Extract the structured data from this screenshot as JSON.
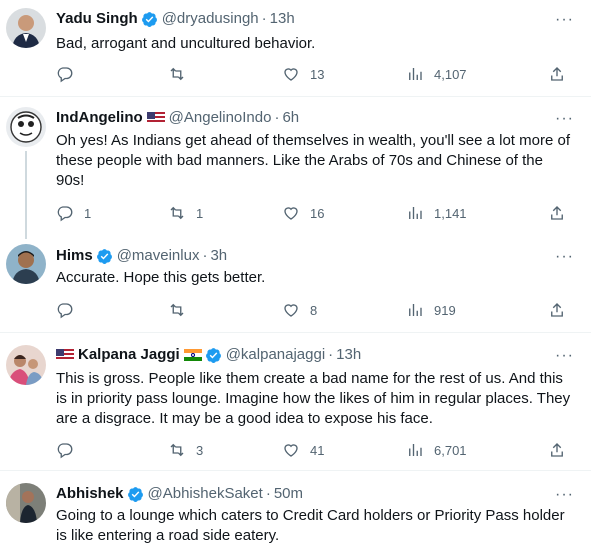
{
  "tweets": [
    {
      "name": "Yadu Singh",
      "handle": "@dryadusingh",
      "time": "13h",
      "text": "Bad, arrogant and uncultured behavior.",
      "replies": "",
      "retweets": "",
      "likes": "13",
      "views": "4,107"
    },
    {
      "name": "IndAngelino",
      "handle": "@AngelinoIndo",
      "time": "6h",
      "text": "Oh yes! As Indians get ahead of themselves in wealth, you'll see a lot more of these people with bad manners. Like the Arabs of 70s and Chinese of the 90s!",
      "replies": "1",
      "retweets": "1",
      "likes": "16",
      "views": "1,141"
    },
    {
      "name": "Hims",
      "handle": "@maveinlux",
      "time": "3h",
      "text": "Accurate. Hope this gets better.",
      "replies": "",
      "retweets": "",
      "likes": "8",
      "views": "919"
    },
    {
      "name": "Kalpana Jaggi",
      "handle": "@kalpanajaggi",
      "time": "13h",
      "text": "This is gross. People like them create a bad name for the rest of us. And this is in priority pass lounge. Imagine how the likes of him in regular places. They are a disgrace.  It may be a good idea to expose his face.",
      "replies": "",
      "retweets": "3",
      "likes": "41",
      "views": "6,701"
    },
    {
      "name": "Abhishek",
      "handle": "@AbhishekSaket",
      "time": "50m",
      "text": "Going to a lounge which caters to Credit Card holders or Priority Pass holder is like entering a road side eatery."
    }
  ],
  "dot": "·",
  "more_glyph": "···",
  "colors": {
    "verified": "#1d9bf0",
    "muted": "#536471",
    "divider": "#eff3f4"
  }
}
